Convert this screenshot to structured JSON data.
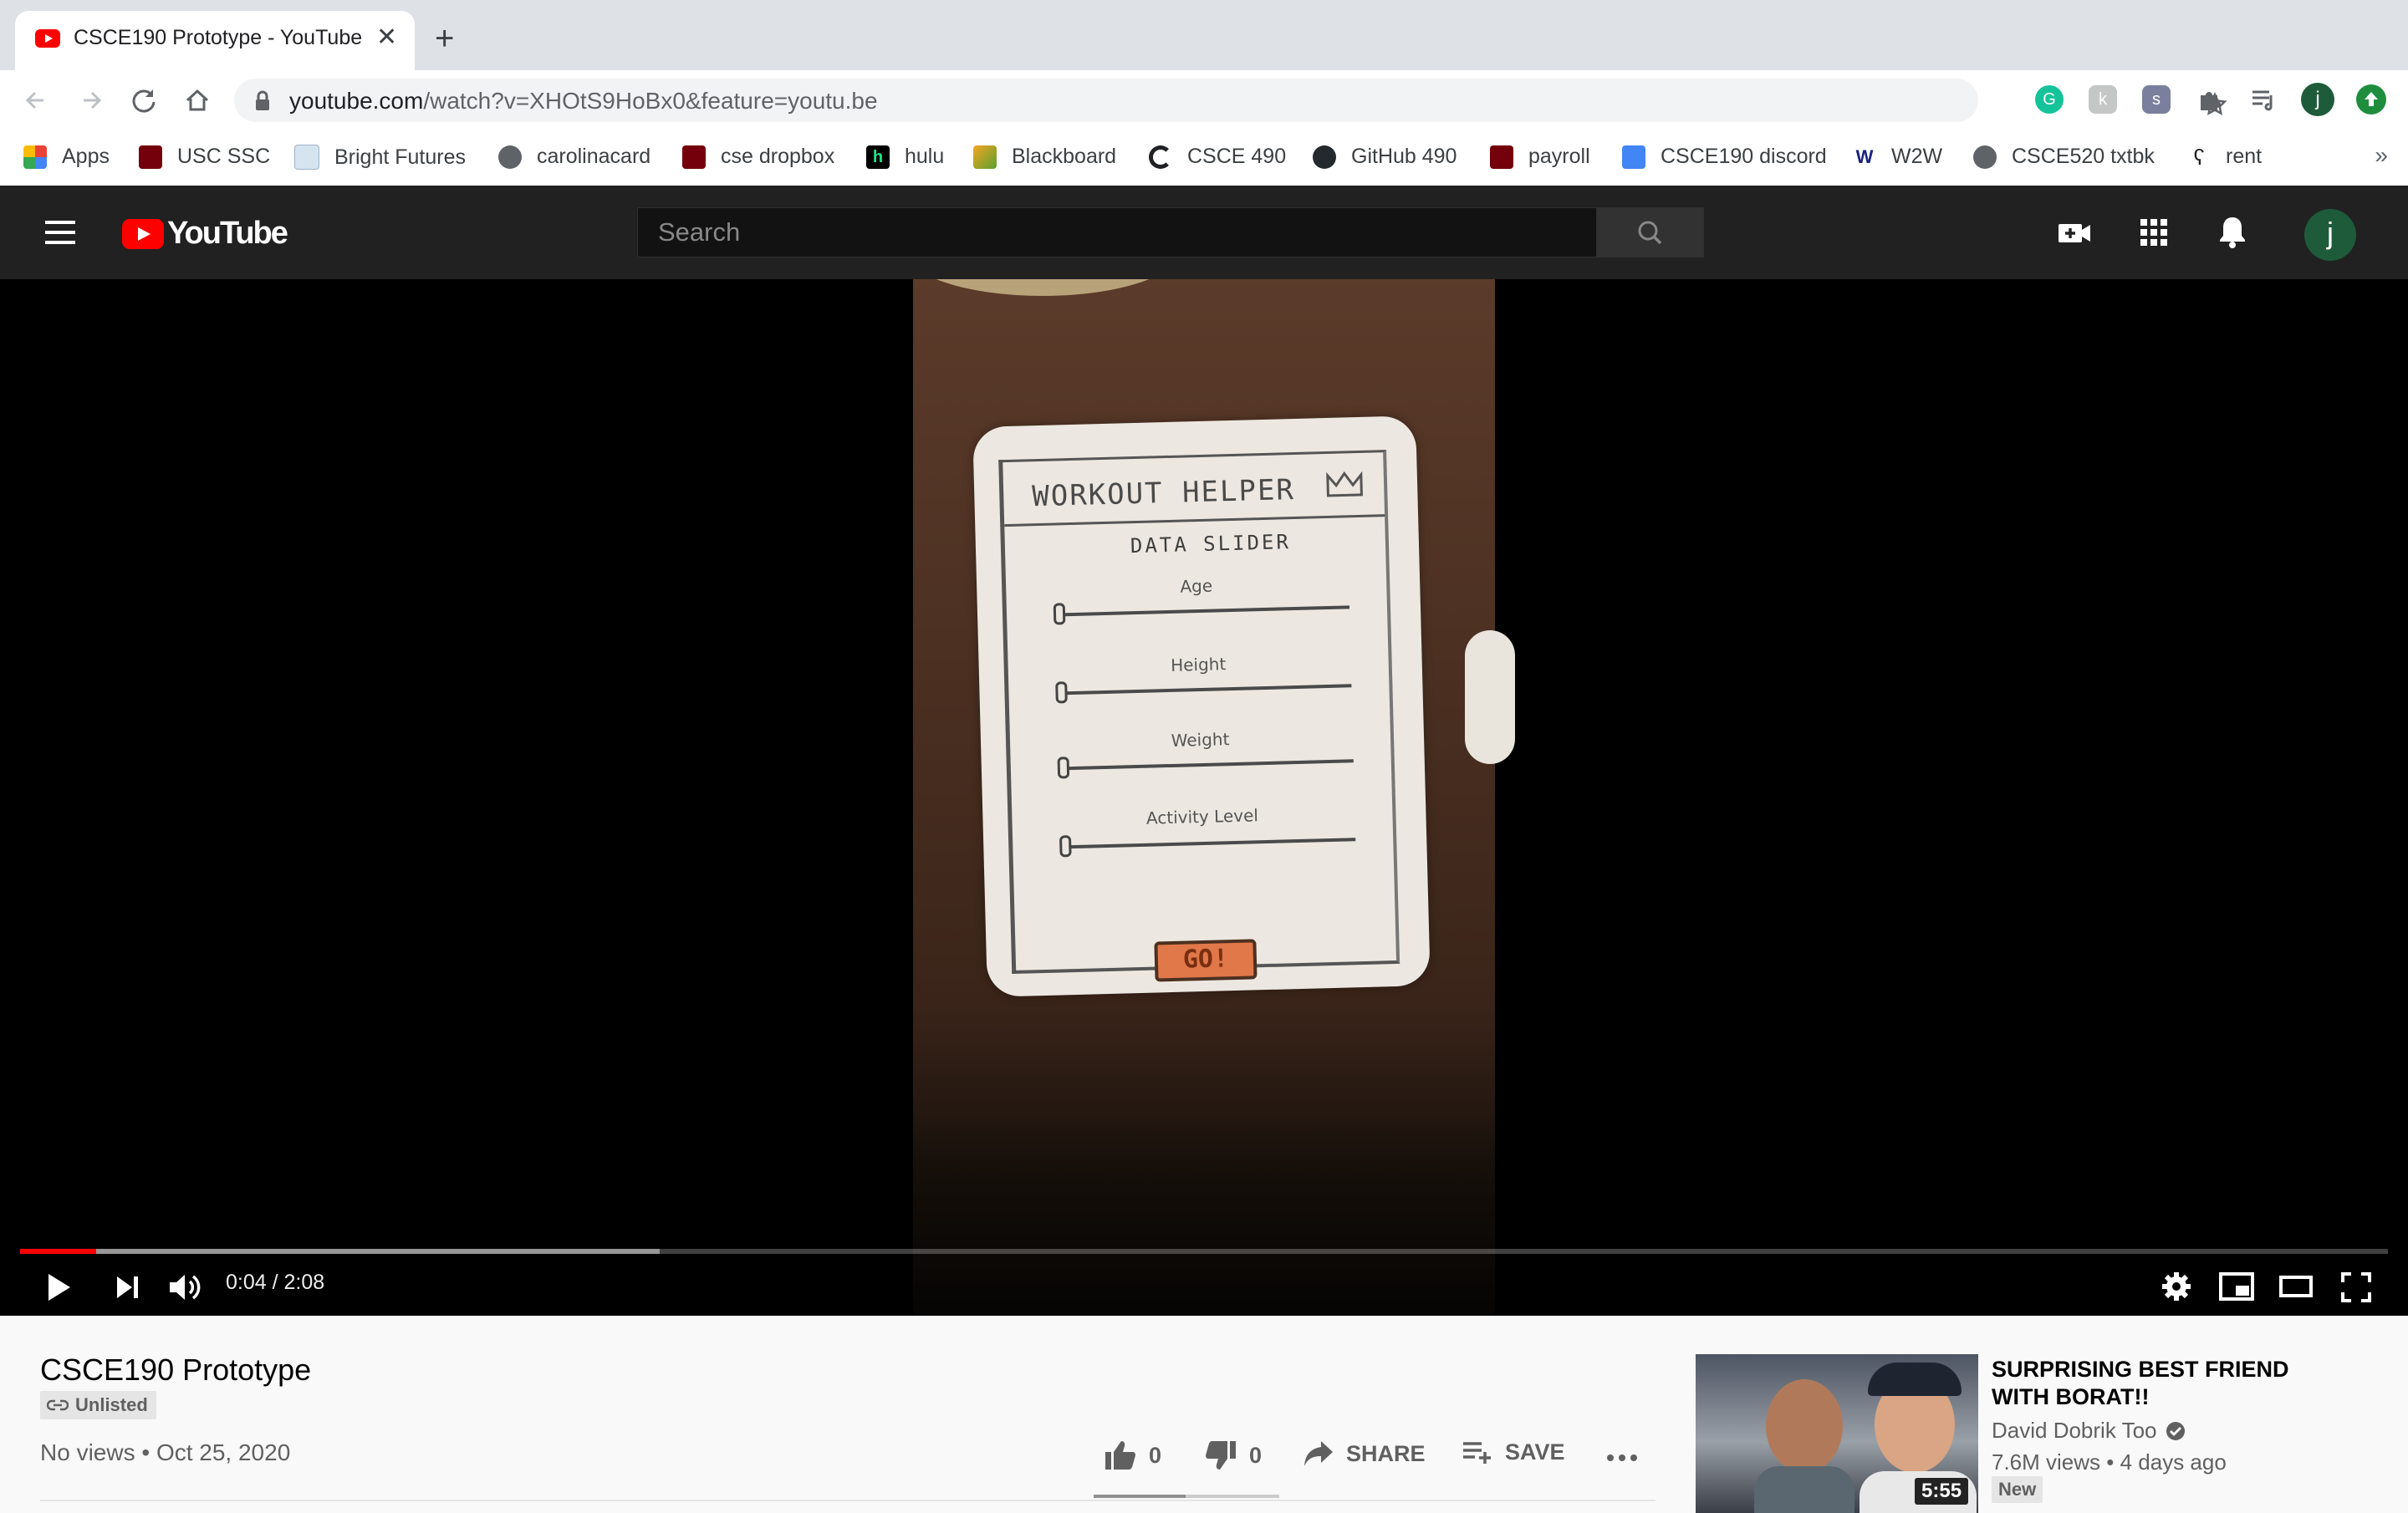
{
  "browser": {
    "tab_title": "CSCE190 Prototype - YouTube",
    "tab_close": "✕",
    "new_tab": "+",
    "url_host": "youtube.com",
    "url_path": "/watch?v=XHOtS9HoBx0&feature=youtu.be",
    "profile_initial": "j",
    "bookmarks": [
      {
        "label": "Apps",
        "icon": "apps-grid-icon"
      },
      {
        "label": "USC SSC",
        "icon": "usc-icon"
      },
      {
        "label": "Bright Futures",
        "icon": "document-icon"
      },
      {
        "label": "carolinacard",
        "icon": "globe-icon"
      },
      {
        "label": "cse dropbox",
        "icon": "usc-icon"
      },
      {
        "label": "hulu",
        "icon": "hulu-icon"
      },
      {
        "label": "Blackboard",
        "icon": "blackboard-icon"
      },
      {
        "label": "CSCE 490",
        "icon": "c-icon"
      },
      {
        "label": "GitHub 490",
        "icon": "github-icon"
      },
      {
        "label": "payroll",
        "icon": "usc-icon"
      },
      {
        "label": "CSCE190 discord",
        "icon": "calendar-icon"
      },
      {
        "label": "W2W",
        "icon": "w-icon"
      },
      {
        "label": "CSCE520 txtbk",
        "icon": "globe-icon"
      },
      {
        "label": "rent",
        "icon": "feather-icon"
      }
    ],
    "bookmarks_more": "»"
  },
  "youtube": {
    "logo_text": "YouTube",
    "search_placeholder": "Search",
    "avatar_initial": "j"
  },
  "player": {
    "current_time": "0:04",
    "duration": "2:08",
    "time_display": "0:04 / 2:08",
    "played_fraction": 0.032,
    "buffered_fraction": 0.27,
    "sketch": {
      "title": "WORKOUT HELPER",
      "subtitle": "DATA SLIDER",
      "sliders": [
        "Age",
        "Height",
        "Weight",
        "Activity Level"
      ],
      "button": "GO!"
    }
  },
  "video": {
    "title": "CSCE190 Prototype",
    "privacy": "Unlisted",
    "meta": "No views • Oct 25, 2020",
    "likes": "0",
    "dislikes": "0",
    "share_label": "SHARE",
    "save_label": "SAVE"
  },
  "recommendation": {
    "title": "SURPRISING BEST FRIEND WITH BORAT!!",
    "channel": "David Dobrik Too",
    "stats": "7.6M views • 4 days ago",
    "badge": "New",
    "duration": "5:55"
  },
  "colors": {
    "youtube_red": "#ff0000",
    "masthead_bg": "#212121",
    "page_bg": "#f9f9f9"
  }
}
